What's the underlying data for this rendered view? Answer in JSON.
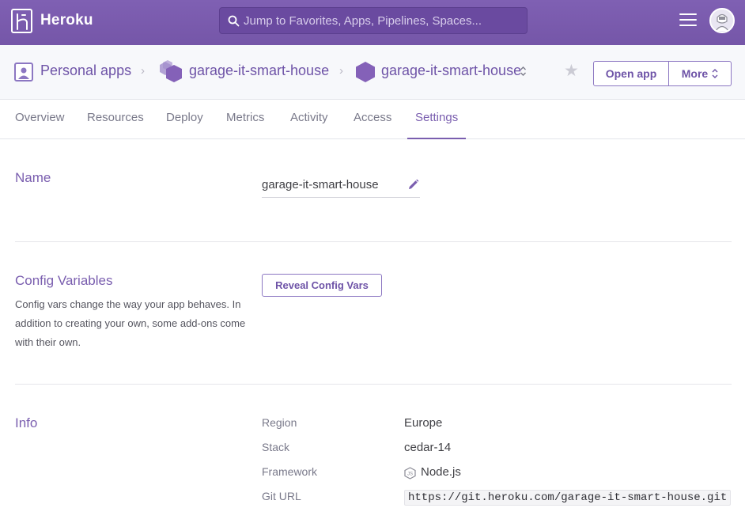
{
  "topbar": {
    "brand": "Heroku",
    "search_placeholder": "Jump to Favorites, Apps, Pipelines, Spaces...",
    "icons": [
      "heroku-logo-icon",
      "search-icon",
      "hamburger-menu-icon",
      "user-avatar"
    ]
  },
  "appbar": {
    "personal_apps": "Personal apps",
    "breadcrumb_app": "garage-it-smart-house",
    "current_app": "garage-it-smart-house",
    "open_app": "Open app",
    "more": "More"
  },
  "tabs": [
    "Overview",
    "Resources",
    "Deploy",
    "Metrics",
    "Activity",
    "Access",
    "Settings"
  ],
  "active_tab": "Settings",
  "name_section": {
    "title": "Name",
    "value": "garage-it-smart-house"
  },
  "config_section": {
    "title": "Config Variables",
    "description": "Config vars change the way your app behaves. In addition to creating your own, some add-ons come with their own.",
    "reveal_button": "Reveal Config Vars"
  },
  "info_section": {
    "title": "Info",
    "region_label": "Region",
    "region_value": "Europe",
    "stack_label": "Stack",
    "stack_value": "cedar-14",
    "framework_label": "Framework",
    "framework_value": "Node.js",
    "git_label": "Git URL",
    "git_value": "https://git.heroku.com/garage-it-smart-house.git"
  },
  "colors": {
    "topbar": "#7f60b3",
    "accent": "#7a5eaf",
    "app_hexagon": "#8461b8"
  }
}
